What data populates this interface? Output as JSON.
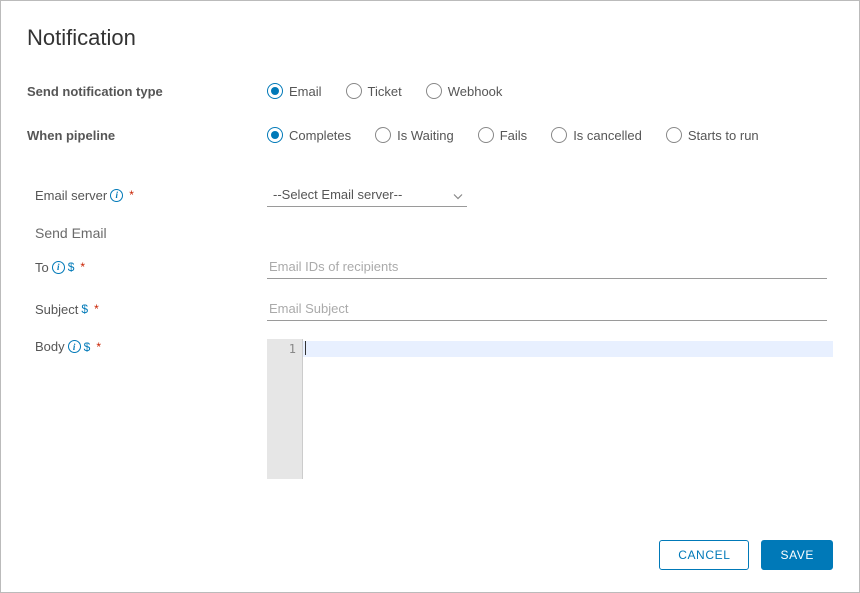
{
  "title": "Notification",
  "notification_type": {
    "label": "Send notification type",
    "selected": "Email",
    "options": [
      "Email",
      "Ticket",
      "Webhook"
    ]
  },
  "pipeline_trigger": {
    "label": "When pipeline",
    "selected": "Completes",
    "options": [
      "Completes",
      "Is Waiting",
      "Fails",
      "Is cancelled",
      "Starts to run"
    ]
  },
  "email_section": {
    "server_label": "Email server",
    "server_placeholder": "--Select Email server--",
    "send_email_heading": "Send Email",
    "to_label": "To",
    "to_placeholder": "Email IDs of recipients",
    "subject_label": "Subject",
    "subject_placeholder": "Email Subject",
    "body_label": "Body",
    "body_line_number": "1"
  },
  "buttons": {
    "cancel": "CANCEL",
    "save": "SAVE"
  }
}
